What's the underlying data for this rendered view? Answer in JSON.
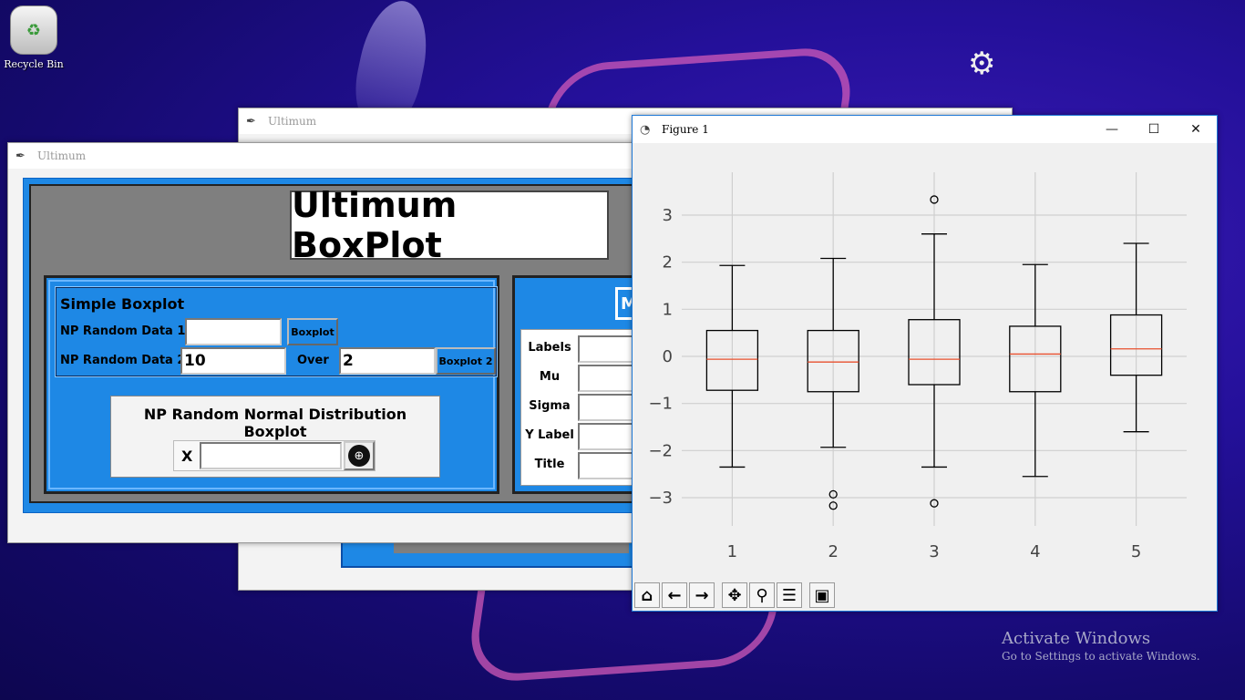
{
  "desktop": {
    "recycle_bin_label": "Recycle Bin",
    "activate_title": "Activate Windows",
    "activate_sub": "Go to Settings to activate Windows."
  },
  "ultimum_back": {
    "title": "Ultimum"
  },
  "ultimum": {
    "title": "Ultimum",
    "heading": "Ultimum BoxPlot",
    "simple": {
      "header": "Simple Boxplot",
      "np_random_data1_label": "NP Random Data 1",
      "np_random_data1_value": "",
      "boxplot_button": "Boxplot",
      "np_random_data2_label": "NP Random Data 2",
      "np_random_data2_value": "10",
      "over_label": "Over",
      "over_value": "2",
      "boxplot2_button": "Boxplot 2"
    },
    "normal_dist": {
      "header": "NP Random Normal Distribution Boxplot",
      "x_label": "X",
      "x_value": ""
    },
    "right_panel": {
      "heading_partial": "M",
      "fields": [
        "Labels",
        "Mu",
        "Sigma",
        "Y Label",
        "Title"
      ]
    }
  },
  "figure": {
    "title": "Figure 1",
    "toolbar": [
      "home-icon",
      "back-icon",
      "forward-icon",
      "pan-icon",
      "zoom-icon",
      "configure-icon",
      "save-icon"
    ]
  },
  "chart_data": {
    "type": "boxplot",
    "categories": [
      "1",
      "2",
      "3",
      "4",
      "5"
    ],
    "ylim": [
      -3.6,
      3.6
    ],
    "yticks": [
      -3,
      -2,
      -1,
      0,
      1,
      2,
      3
    ],
    "yticklabels": [
      "−3",
      "−2",
      "−1",
      "0",
      "1",
      "2",
      "3"
    ],
    "grid": true,
    "boxes": [
      {
        "whisker_low": -2.35,
        "q1": -0.72,
        "median": -0.06,
        "q3": 0.55,
        "whisker_high": 1.93,
        "outliers": []
      },
      {
        "whisker_low": -1.93,
        "q1": -0.75,
        "median": -0.12,
        "q3": 0.55,
        "whisker_high": 2.08,
        "outliers": [
          -2.93,
          -3.17
        ]
      },
      {
        "whisker_low": -2.35,
        "q1": -0.6,
        "median": -0.06,
        "q3": 0.78,
        "whisker_high": 2.6,
        "outliers": [
          3.33,
          -3.12
        ]
      },
      {
        "whisker_low": -2.55,
        "q1": -0.75,
        "median": 0.05,
        "q3": 0.64,
        "whisker_high": 1.95,
        "outliers": []
      },
      {
        "whisker_low": -1.6,
        "q1": -0.4,
        "median": 0.16,
        "q3": 0.88,
        "whisker_high": 2.4,
        "outliers": []
      }
    ],
    "colors": {
      "box": "#000000",
      "median": "#e8502e",
      "grid": "#cfcfcf",
      "background": "#f0f0f0"
    }
  }
}
